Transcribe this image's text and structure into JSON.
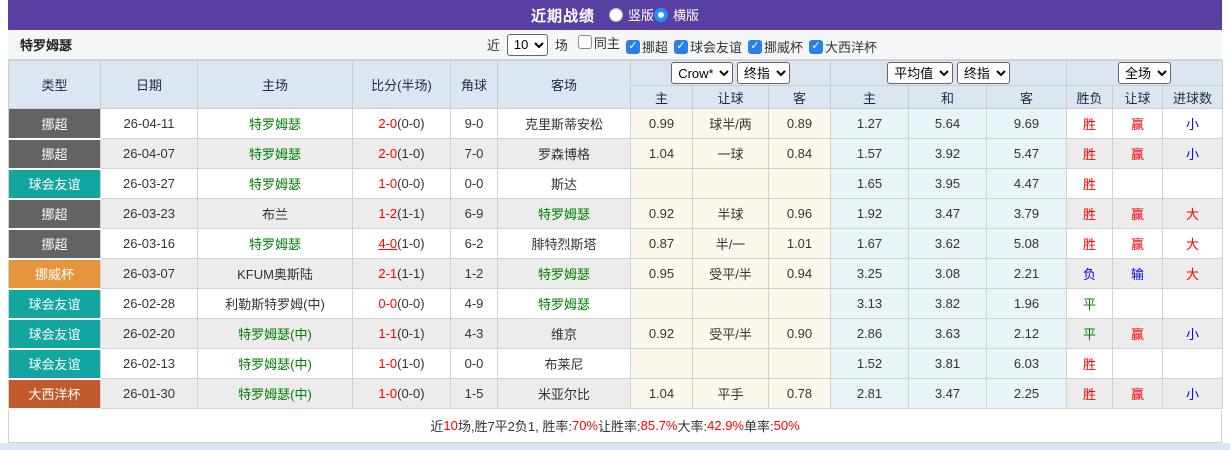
{
  "header": {
    "title": "近期战绩",
    "radios": [
      {
        "label": "竖版",
        "checked": false
      },
      {
        "label": "横版",
        "checked": true
      }
    ]
  },
  "filter": {
    "team": "特罗姆瑟",
    "near_label": "近",
    "matches_select": "10",
    "matches_label": "场",
    "checkboxes": [
      {
        "label": "同主",
        "checked": false
      },
      {
        "label": "挪超",
        "checked": true
      },
      {
        "label": "球会友谊",
        "checked": true
      },
      {
        "label": "挪威杯",
        "checked": true
      },
      {
        "label": "大西洋杯",
        "checked": true
      }
    ]
  },
  "table": {
    "static_headers": [
      "类型",
      "日期",
      "主场",
      "比分(半场)",
      "角球",
      "客场"
    ],
    "odds_group1": {
      "selects": [
        "Crow*",
        "终指"
      ],
      "sub": [
        "主",
        "让球",
        "客"
      ]
    },
    "odds_group2": {
      "selects": [
        "平均值",
        "终指"
      ],
      "sub": [
        "主",
        "和",
        "客"
      ]
    },
    "result_group": {
      "selects": [
        "全场"
      ],
      "sub": [
        "胜负",
        "让球",
        "进球数"
      ]
    },
    "rows": [
      {
        "type": "挪超",
        "date": "26-04-11",
        "home": "特罗姆瑟",
        "home_green": true,
        "ft": "2-0",
        "ht": "(0-0)",
        "ft_underline": false,
        "corners": "9-0",
        "away": "克里斯蒂安松",
        "away_green": false,
        "hcp": [
          "0.99",
          "球半/两",
          "0.89"
        ],
        "avg": [
          "1.27",
          "5.64",
          "9.69"
        ],
        "res": [
          "胜",
          "赢",
          "小"
        ]
      },
      {
        "type": "挪超",
        "date": "26-04-07",
        "home": "特罗姆瑟",
        "home_green": true,
        "ft": "2-0",
        "ht": "(1-0)",
        "ft_underline": false,
        "corners": "7-0",
        "away": "罗森博格",
        "away_green": false,
        "hcp": [
          "1.04",
          "一球",
          "0.84"
        ],
        "avg": [
          "1.57",
          "3.92",
          "5.47"
        ],
        "res": [
          "胜",
          "赢",
          "小"
        ]
      },
      {
        "type": "球会友谊",
        "date": "26-03-27",
        "home": "特罗姆瑟",
        "home_green": true,
        "ft": "1-0",
        "ht": "(0-0)",
        "ft_underline": false,
        "corners": "0-0",
        "away": "斯达",
        "away_green": false,
        "hcp": [
          "",
          "",
          ""
        ],
        "avg": [
          "1.65",
          "3.95",
          "4.47"
        ],
        "res": [
          "胜",
          "",
          ""
        ]
      },
      {
        "type": "挪超",
        "date": "26-03-23",
        "home": "布兰",
        "home_green": false,
        "ft": "1-2",
        "ht": "(1-1)",
        "ft_underline": false,
        "corners": "6-9",
        "away": "特罗姆瑟",
        "away_green": true,
        "hcp": [
          "0.92",
          "半球",
          "0.96"
        ],
        "avg": [
          "1.92",
          "3.47",
          "3.79"
        ],
        "res": [
          "胜",
          "赢",
          "大"
        ]
      },
      {
        "type": "挪超",
        "date": "26-03-16",
        "home": "特罗姆瑟",
        "home_green": true,
        "ft": "4-0",
        "ht": "(1-0)",
        "ft_underline": true,
        "corners": "6-2",
        "away": "腓特烈斯塔",
        "away_green": false,
        "hcp": [
          "0.87",
          "半/一",
          "1.01"
        ],
        "avg": [
          "1.67",
          "3.62",
          "5.08"
        ],
        "res": [
          "胜",
          "赢",
          "大"
        ]
      },
      {
        "type": "挪威杯",
        "date": "26-03-07",
        "home": "KFUM奥斯陆",
        "home_green": false,
        "ft": "2-1",
        "ht": "(1-1)",
        "ft_underline": false,
        "corners": "1-2",
        "away": "特罗姆瑟",
        "away_green": true,
        "hcp": [
          "0.95",
          "受平/半",
          "0.94"
        ],
        "avg": [
          "3.25",
          "3.08",
          "2.21"
        ],
        "res": [
          "负",
          "输",
          "大"
        ]
      },
      {
        "type": "球会友谊",
        "date": "26-02-28",
        "home": "利勒斯特罗姆(中)",
        "home_green": false,
        "ft": "0-0",
        "ht": "(0-0)",
        "ft_underline": false,
        "corners": "4-9",
        "away": "特罗姆瑟",
        "away_green": true,
        "hcp": [
          "",
          "",
          ""
        ],
        "avg": [
          "3.13",
          "3.82",
          "1.96"
        ],
        "res": [
          "平",
          "",
          ""
        ]
      },
      {
        "type": "球会友谊",
        "date": "26-02-20",
        "home": "特罗姆瑟(中)",
        "home_green": true,
        "ft": "1-1",
        "ht": "(0-1)",
        "ft_underline": false,
        "corners": "4-3",
        "away": "维京",
        "away_green": false,
        "hcp": [
          "0.92",
          "受平/半",
          "0.90"
        ],
        "avg": [
          "2.86",
          "3.63",
          "2.12"
        ],
        "res": [
          "平",
          "赢",
          "小"
        ]
      },
      {
        "type": "球会友谊",
        "date": "26-02-13",
        "home": "特罗姆瑟(中)",
        "home_green": true,
        "ft": "1-0",
        "ht": "(1-0)",
        "ft_underline": false,
        "corners": "0-0",
        "away": "布莱尼",
        "away_green": false,
        "hcp": [
          "",
          "",
          ""
        ],
        "avg": [
          "1.52",
          "3.81",
          "6.03"
        ],
        "res": [
          "胜",
          "",
          ""
        ]
      },
      {
        "type": "大西洋杯",
        "date": "26-01-30",
        "home": "特罗姆瑟(中)",
        "home_green": true,
        "ft": "1-0",
        "ht": "(0-0)",
        "ft_underline": false,
        "corners": "1-5",
        "away": "米亚尔比",
        "away_green": false,
        "hcp": [
          "1.04",
          "平手",
          "0.78"
        ],
        "avg": [
          "2.81",
          "3.47",
          "2.25"
        ],
        "res": [
          "胜",
          "赢",
          "小"
        ]
      }
    ]
  },
  "footer": {
    "segments": [
      {
        "text": "近",
        "red": false
      },
      {
        "text": "10",
        "red": true
      },
      {
        "text": "场,胜7平2负1, 胜率:",
        "red": false
      },
      {
        "text": "70%",
        "red": true
      },
      {
        "text": " 让胜率:",
        "red": false
      },
      {
        "text": "85.7%",
        "red": true
      },
      {
        "text": " 大率:",
        "red": false
      },
      {
        "text": "42.9%",
        "red": true
      },
      {
        "text": " 单率:",
        "red": false
      },
      {
        "text": "50%",
        "red": true
      }
    ]
  },
  "colors": {
    "topbar": "#583fa2",
    "accent_blue": "#2a7fe8",
    "team_green": "#008000",
    "score_red": "#ff0000",
    "type_badges": {
      "挪超": "#636363",
      "球会友谊": "#13a5a0",
      "挪威杯": "#e5953c",
      "大西洋杯": "#c05a2c"
    },
    "result_text": {
      "胜": "#ff0000",
      "平": "#008000",
      "负": "#0000ee",
      "赢": "#ff0000",
      "输": "#0000ee",
      "大": "#ff0000",
      "小": "#0000ee"
    }
  }
}
